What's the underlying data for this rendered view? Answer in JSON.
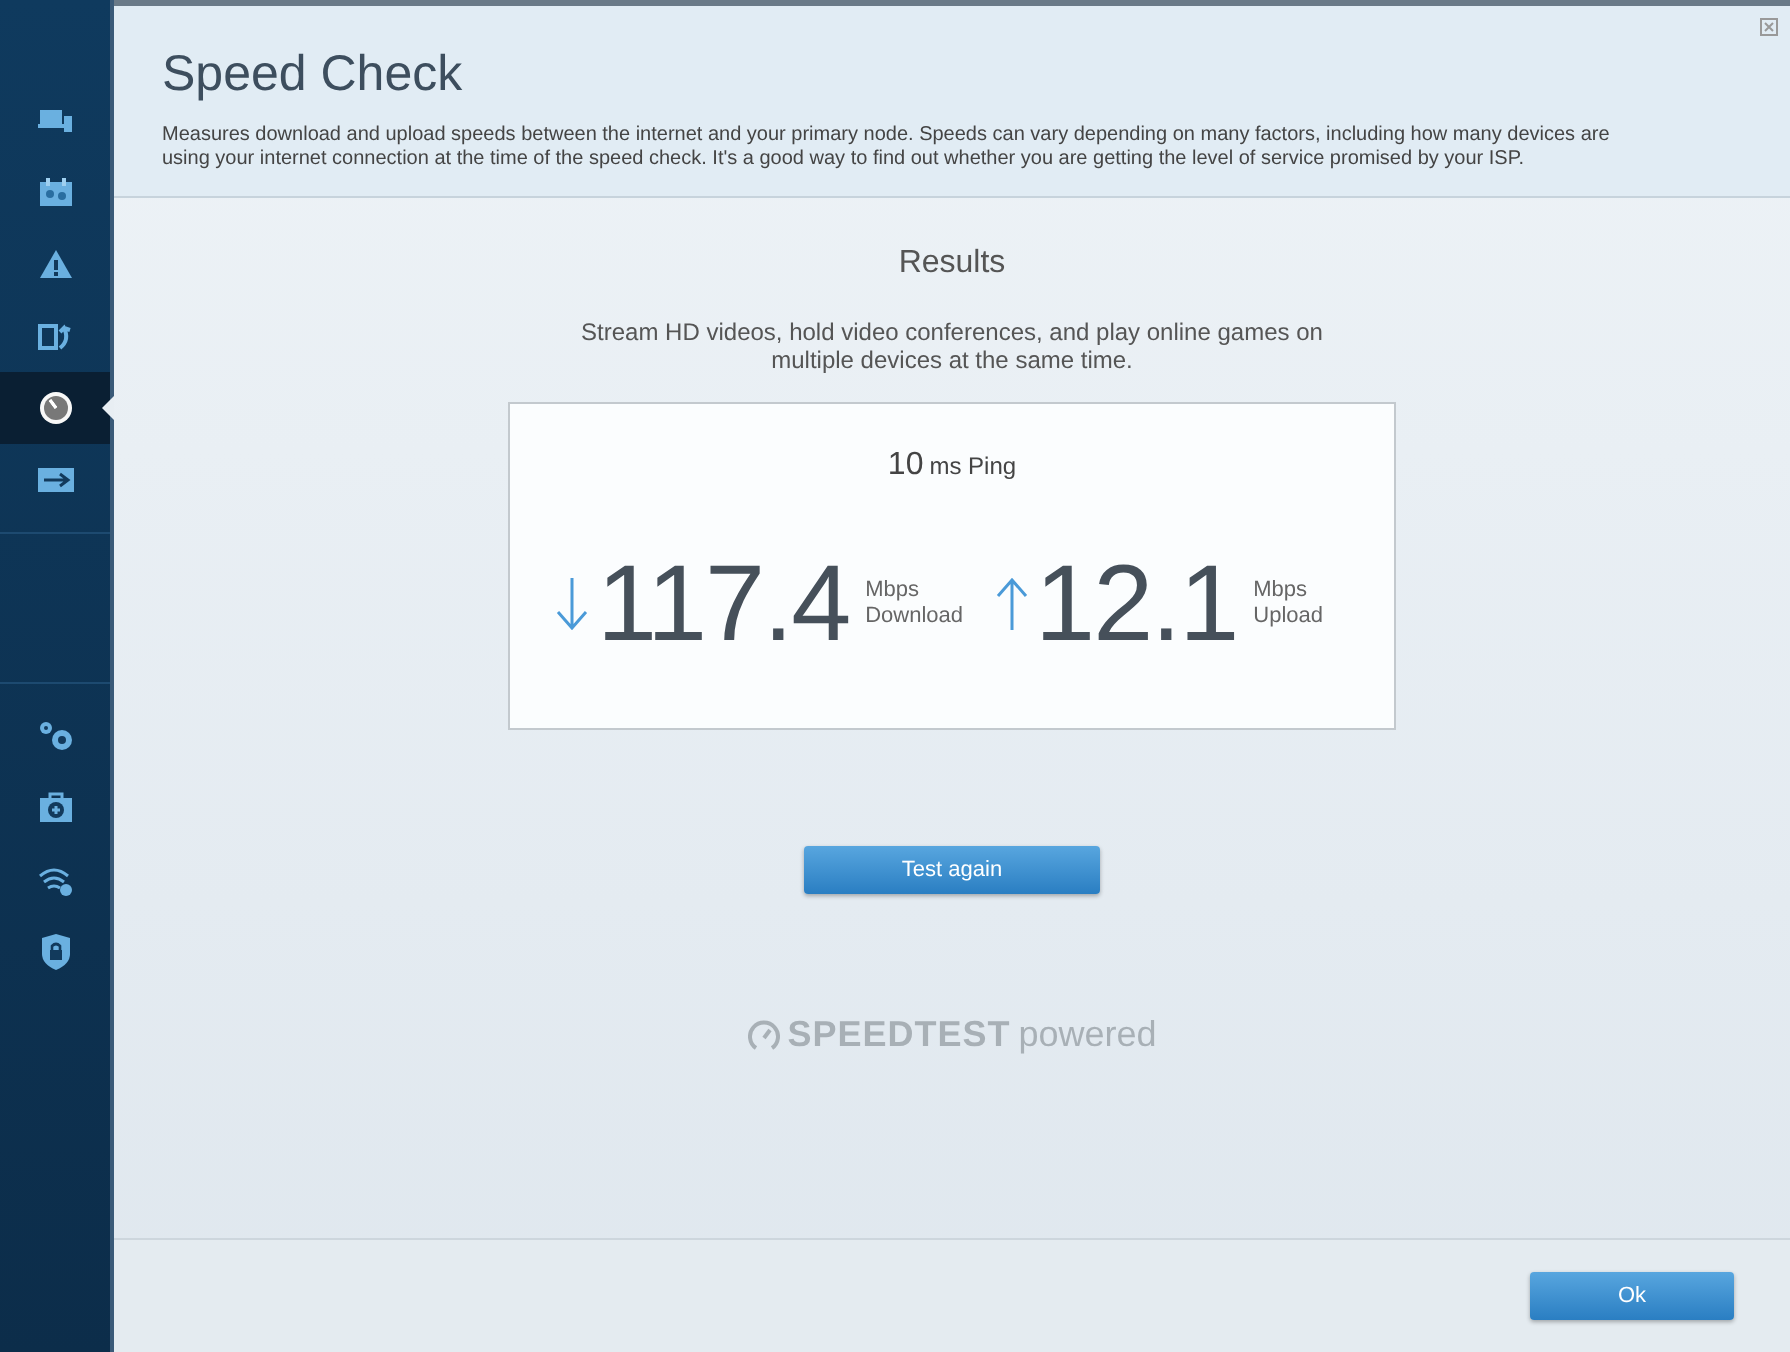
{
  "sidebar": {
    "items": [
      {
        "kind": "devices",
        "selected": false
      },
      {
        "kind": "family",
        "selected": false
      },
      {
        "kind": "alert",
        "selected": false
      },
      {
        "kind": "restore",
        "selected": false
      },
      {
        "kind": "speed",
        "selected": true
      },
      {
        "kind": "usb",
        "selected": false
      }
    ],
    "bottom_items": [
      {
        "kind": "settings",
        "selected": false
      },
      {
        "kind": "kit",
        "selected": false
      },
      {
        "kind": "wifi",
        "selected": false
      },
      {
        "kind": "shield",
        "selected": false
      }
    ]
  },
  "header": {
    "title": "Speed Check",
    "description": "Measures download and upload speeds between the internet and your primary node. Speeds can vary depending on many factors, including how many devices are using your internet connection at the time of the speed check. It's a good way to find out whether you are getting the level of service promised by your ISP."
  },
  "results": {
    "title": "Results",
    "summary": "Stream HD videos, hold video conferences, and play online games on multiple devices at the same time.",
    "ping": {
      "value": "10",
      "unit": "ms Ping"
    },
    "download": {
      "value": "117.4",
      "unit": "Mbps",
      "label": "Download"
    },
    "upload": {
      "value": "12.1",
      "unit": "Mbps",
      "label": "Upload"
    }
  },
  "test_button": "Test again",
  "branding": {
    "name": "SPEEDTEST",
    "suffix": "powered"
  },
  "footer": {
    "ok_button": "Ok"
  }
}
